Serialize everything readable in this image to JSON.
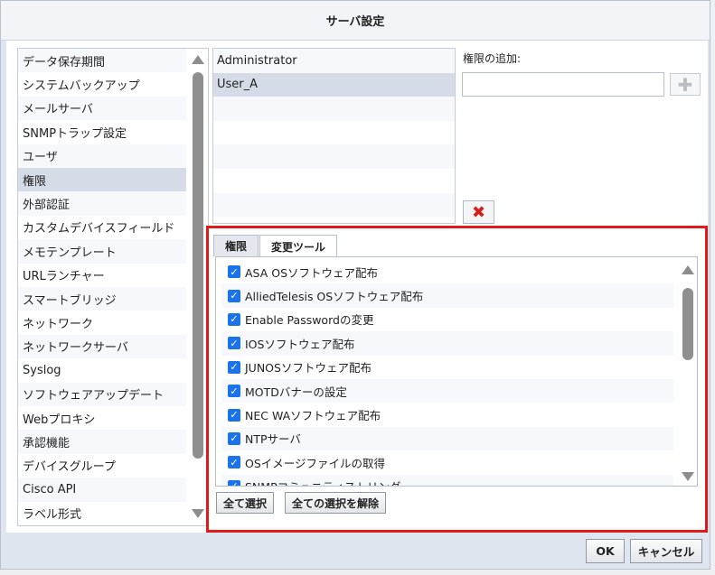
{
  "dialog": {
    "title": "サーバ設定"
  },
  "categories": [
    "データ保存期間",
    "システムバックアップ",
    "メールサーバ",
    "SNMPトラップ設定",
    "ユーザ",
    "権限",
    "外部認証",
    "カスタムデバイスフィールド",
    "メモテンプレート",
    "URLランチャー",
    "スマートブリッジ",
    "ネットワーク",
    "ネットワークサーバ",
    "Syslog",
    "ソフトウェアアップデート",
    "Webプロキシ",
    "承認機能",
    "デバイスグループ",
    "Cisco API",
    "ラベル形式"
  ],
  "selected_category": "権限",
  "users": [
    "Administrator",
    "User_A"
  ],
  "selected_user": "User_A",
  "permission": {
    "add_label": "権限の追加:",
    "input_value": ""
  },
  "tabs": [
    "権限",
    "変更ツール"
  ],
  "active_tab": "変更ツール",
  "tools": [
    {
      "label": "ASA OSソフトウェア配布",
      "checked": true
    },
    {
      "label": "AlliedTelesis OSソフトウェア配布",
      "checked": true
    },
    {
      "label": "Enable Passwordの変更",
      "checked": true
    },
    {
      "label": "IOSソフトウェア配布",
      "checked": true
    },
    {
      "label": "JUNOSソフトウェア配布",
      "checked": true
    },
    {
      "label": "MOTDバナーの設定",
      "checked": true
    },
    {
      "label": "NEC WAソフトウェア配布",
      "checked": true
    },
    {
      "label": "NTPサーバ",
      "checked": true
    },
    {
      "label": "OSイメージファイルの取得",
      "checked": true
    },
    {
      "label": "SNMPコミュニティストリング",
      "checked": true
    }
  ],
  "buttons": {
    "select_all": "全て選択",
    "deselect_all": "全ての選択を解除",
    "ok": "OK",
    "cancel": "キャンセル"
  },
  "icons": {
    "add": "plus-icon",
    "delete": "x-icon",
    "check": "checkmark-icon"
  },
  "colors": {
    "highlight_border": "#e01919",
    "checkbox": "#1a73e8",
    "delete_icon": "#d0221b",
    "selected_row": "#d5dce7"
  }
}
